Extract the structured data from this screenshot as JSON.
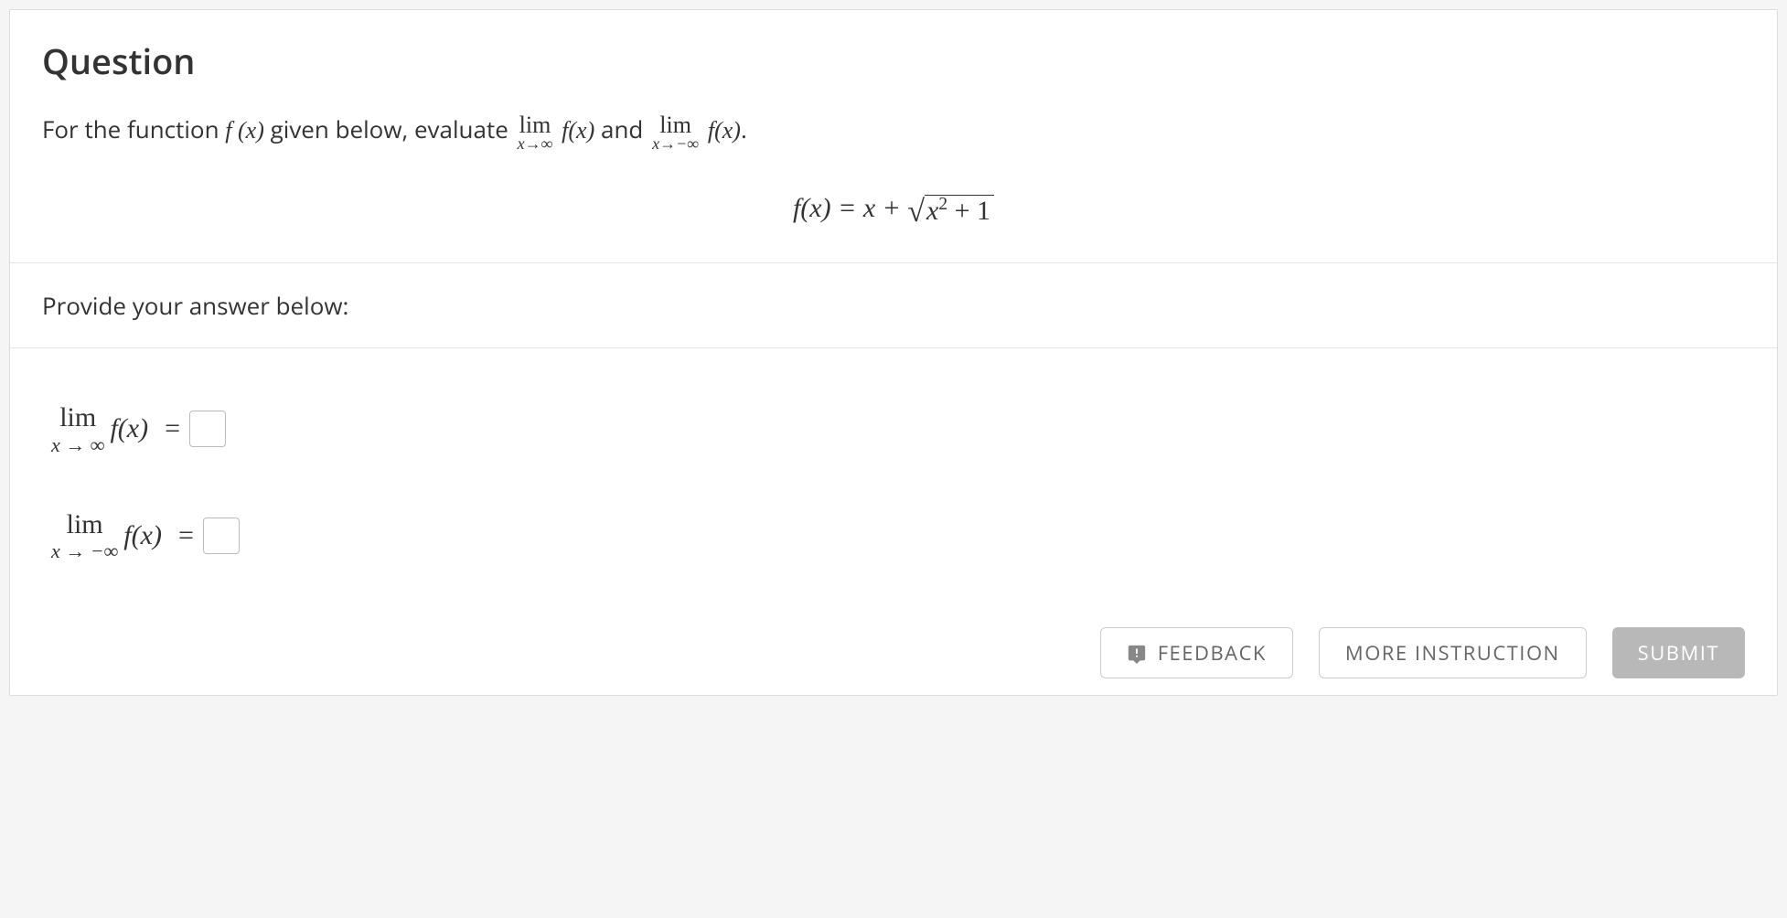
{
  "question": {
    "title": "Question",
    "prompt_prefix": "For the function",
    "fx": "f (x)",
    "prompt_mid": "given below, evaluate",
    "lim_label": "lim",
    "lim1_sub": "x→∞",
    "fx2": "f(x)",
    "and": "and",
    "lim2_sub": "x→−∞",
    "fx3": "f(x)",
    "period": ".",
    "equation_lhs": "f(x) = x + ",
    "equation_sqrt_body": "x",
    "equation_sqrt_exp": "2",
    "equation_sqrt_tail": " + 1"
  },
  "answer_prompt": "Provide your answer below:",
  "answers": {
    "row1_lim": "lim",
    "row1_sub": "x → ∞",
    "row1_fx": "f(x)",
    "row1_eq": "=",
    "row1_value": "",
    "row2_lim": "lim",
    "row2_sub": "x → −∞",
    "row2_fx": "f(x)",
    "row2_eq": "=",
    "row2_value": ""
  },
  "buttons": {
    "feedback": "FEEDBACK",
    "more": "MORE INSTRUCTION",
    "submit": "SUBMIT"
  }
}
